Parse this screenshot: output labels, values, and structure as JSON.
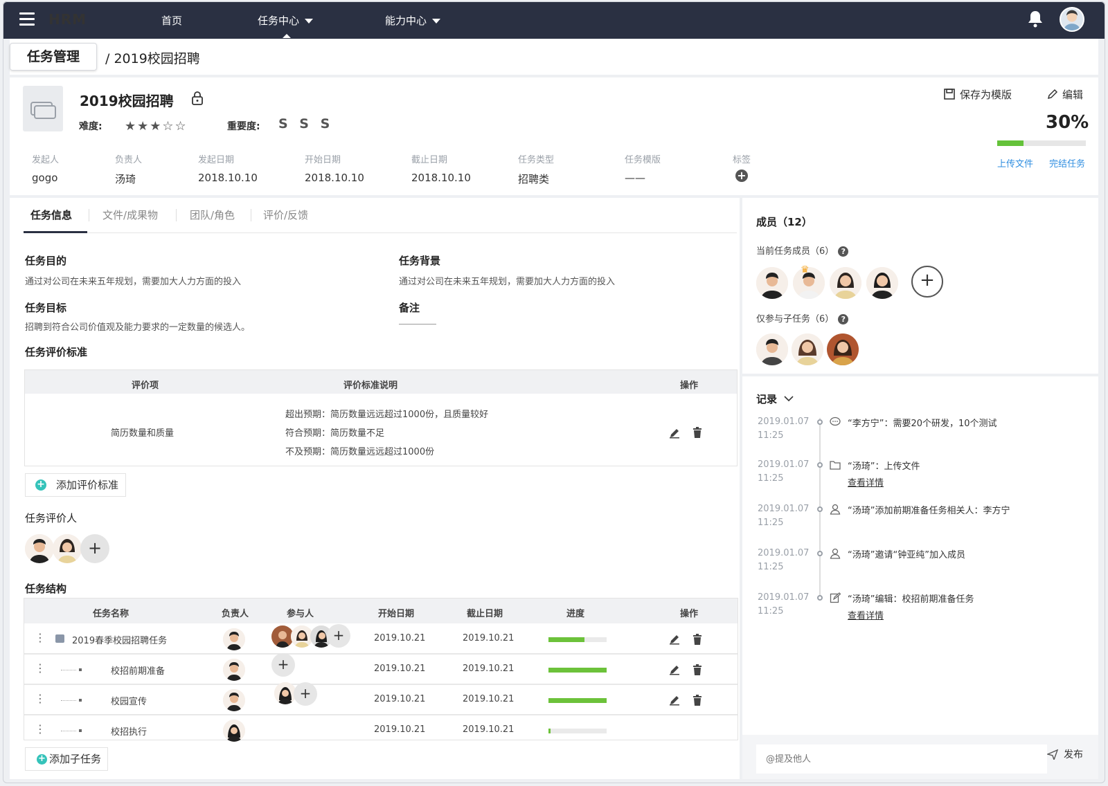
{
  "nav": {
    "logo": "HRM",
    "items": [
      {
        "label": "首页"
      },
      {
        "label": "任务中心"
      },
      {
        "label": "能力中心"
      }
    ]
  },
  "breadcrumb": {
    "root": "任务管理",
    "current": "/ 2019校园招聘"
  },
  "task": {
    "title": "2019校园招聘",
    "difficulty_label": "难度:",
    "difficulty": 3,
    "difficulty_max": 5,
    "stars_text": "★★★☆☆",
    "importance_label": "重要度:",
    "importance": "S S S",
    "save_template": "保存为模版",
    "edit": "编辑",
    "progress_text": "30%",
    "progress": 0.3,
    "upload": "上传文件",
    "complete": "完结任务",
    "meta": [
      {
        "label": "发起人",
        "value": "gogo"
      },
      {
        "label": "负责人",
        "value": "汤琦"
      },
      {
        "label": "发起日期",
        "value": "2018.10.10"
      },
      {
        "label": "开始日期",
        "value": "2018.10.10"
      },
      {
        "label": "截止日期",
        "value": "2018.10.10"
      },
      {
        "label": "任务类型",
        "value": "招聘类"
      },
      {
        "label": "任务模版",
        "value": "——"
      },
      {
        "label": "标签",
        "value": ""
      }
    ]
  },
  "tabs": [
    "任务信息",
    "文件/成果物",
    "团队/角色",
    "评价/反馈"
  ],
  "info": {
    "purpose_title": "任务目的",
    "purpose_text": "通过对公司在未来五年规划，需要加大人力方面的投入",
    "background_title": "任务背景",
    "background_text": "通过对公司在未来五年规划，需要加大人力方面的投入",
    "goal_title": "任务目标",
    "goal_text": "招聘到符合公司价值观及能力要求的一定数量的候选人。",
    "note_title": "备注",
    "eval_title": "任务评价标准"
  },
  "eval_table": {
    "headers": [
      "评价项",
      "评价标准说明",
      "操作"
    ],
    "rows": [
      {
        "item": "简历数量和质量",
        "lines": [
          "超出预期：简历数量远远超过1000份，且质量较好",
          "符合预期：简历数量不足",
          "不及预期：简历数量远远超过1000份"
        ]
      }
    ],
    "add_label": "添加评价标准"
  },
  "evaluators_title": "任务评价人",
  "structure": {
    "title": "任务结构",
    "headers": [
      "任务名称",
      "负责人",
      "参与人",
      "开始日期",
      "截止日期",
      "进度",
      "操作"
    ],
    "rows": [
      {
        "name": "2019春季校园招聘任务",
        "start": "2019.10.21",
        "end": "2019.10.21",
        "progress": 0.62
      },
      {
        "name": "校招前期准备",
        "start": "2019.10.21",
        "end": "2019.10.21",
        "progress": 1.0
      },
      {
        "name": "校园宣传",
        "start": "2019.10.21",
        "end": "2019.10.21",
        "progress": 1.0
      },
      {
        "name": "校招执行",
        "start": "2019.10.21",
        "end": "2019.10.21",
        "progress": 0.04
      }
    ],
    "add_label": "添加子任务"
  },
  "members": {
    "title": "成员（12）",
    "current_label": "当前任务成员（6）",
    "sub_label": "仅参与子任务（6）"
  },
  "log": {
    "title": "记录",
    "entries": [
      {
        "date": "2019.01.07",
        "time": "11:25",
        "text": "“李方宁”：需要20个研发，10个测试",
        "link": ""
      },
      {
        "date": "2019.01.07",
        "time": "11:25",
        "text": "“汤琦”：上传文件",
        "link": "查看详情"
      },
      {
        "date": "2019.01.07",
        "time": "11:25",
        "text": "“汤琦”添加前期准备任务相关人：李方宁",
        "link": ""
      },
      {
        "date": "2019.01.07",
        "time": "11:25",
        "text": "“汤琦”邀请“钟亚纯”加入成员",
        "link": ""
      },
      {
        "date": "2019.01.07",
        "time": "11:25",
        "text": "“汤琦”编辑：校招前期准备任务",
        "link": "查看详情"
      }
    ],
    "input_placeholder": "@提及他人",
    "send": "发布"
  },
  "colors": {
    "nav": "#2a3042",
    "accent_green": "#64c23a",
    "link": "#2f8ee0",
    "add_teal": "#35c3ba"
  }
}
